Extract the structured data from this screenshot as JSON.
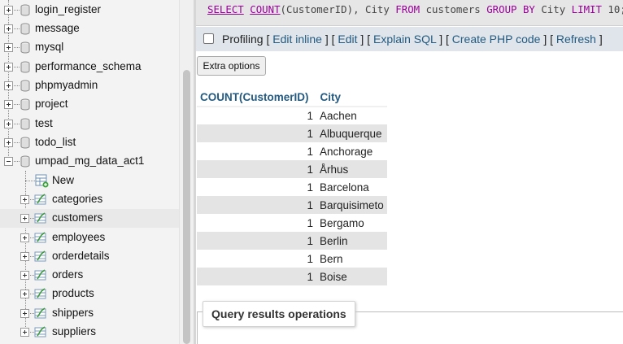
{
  "nav": {
    "databases": [
      {
        "label": "login_register"
      },
      {
        "label": "message"
      },
      {
        "label": "mysql"
      },
      {
        "label": "performance_schema"
      },
      {
        "label": "phpmyadmin"
      },
      {
        "label": "project"
      },
      {
        "label": "test"
      },
      {
        "label": "todo_list"
      },
      {
        "label": "umpad_mg_data_act1"
      }
    ],
    "new_label": "New",
    "tables": [
      {
        "label": "categories"
      },
      {
        "label": "customers"
      },
      {
        "label": "employees"
      },
      {
        "label": "orderdetails"
      },
      {
        "label": "orders"
      },
      {
        "label": "products"
      },
      {
        "label": "shippers"
      },
      {
        "label": "suppliers"
      }
    ],
    "selected_table": "customers"
  },
  "sql": {
    "select": "SELECT",
    "count_fn": "COUNT",
    "args": "(CustomerID), City ",
    "from": "FROM",
    "table": " customers ",
    "group_by": "GROUP BY",
    "group_col": " City ",
    "limit": "LIMIT",
    "limit_val": " 10;"
  },
  "profiling": {
    "label": "Profiling",
    "open1": " [ ",
    "edit_inline": "Edit inline",
    "sep1": " ] [ ",
    "edit": "Edit",
    "sep2": " ] [ ",
    "explain_sql": "Explain SQL",
    "sep3": " ] [ ",
    "create_php": "Create PHP code",
    "sep4": " ] [ ",
    "refresh": "Refresh",
    "close": " ]"
  },
  "extra_options_label": "Extra options",
  "results": {
    "headers": [
      "COUNT(CustomerID)",
      "City"
    ],
    "rows": [
      [
        "1",
        "Aachen"
      ],
      [
        "1",
        "Albuquerque"
      ],
      [
        "1",
        "Anchorage"
      ],
      [
        "1",
        "Århus"
      ],
      [
        "1",
        "Barcelona"
      ],
      [
        "1",
        "Barquisimeto"
      ],
      [
        "1",
        "Bergamo"
      ],
      [
        "1",
        "Berlin"
      ],
      [
        "1",
        "Bern"
      ],
      [
        "1",
        "Boise"
      ]
    ]
  },
  "query_ops_label": "Query results operations",
  "colors": {
    "link": "#235a81",
    "keyword": "#990099",
    "row_alt": "#e4e4e4"
  }
}
